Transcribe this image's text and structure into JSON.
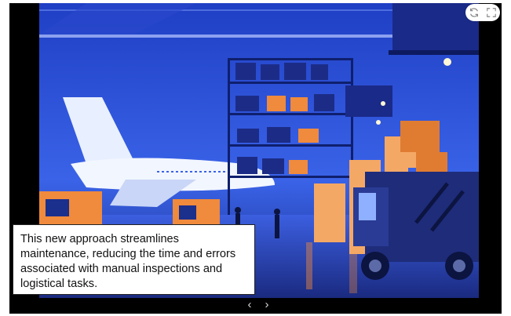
{
  "slide": {
    "caption": "This new approach streamlines maintenance, reducing the time and errors associated with manual inspections and logistical tasks.",
    "image_alt": "Illustration of a warehouse hangar with an airplane, shelves of boxes, forklifts and a delivery truck"
  },
  "navigation": {
    "prev_label": "‹",
    "next_label": "›"
  },
  "controls": {
    "refresh_icon": "refresh-icon",
    "fullscreen_icon": "fullscreen-icon"
  },
  "colors": {
    "scene_blue": "#2b4fd8",
    "accent_orange": "#f08a3c",
    "frame_black": "#000000"
  }
}
